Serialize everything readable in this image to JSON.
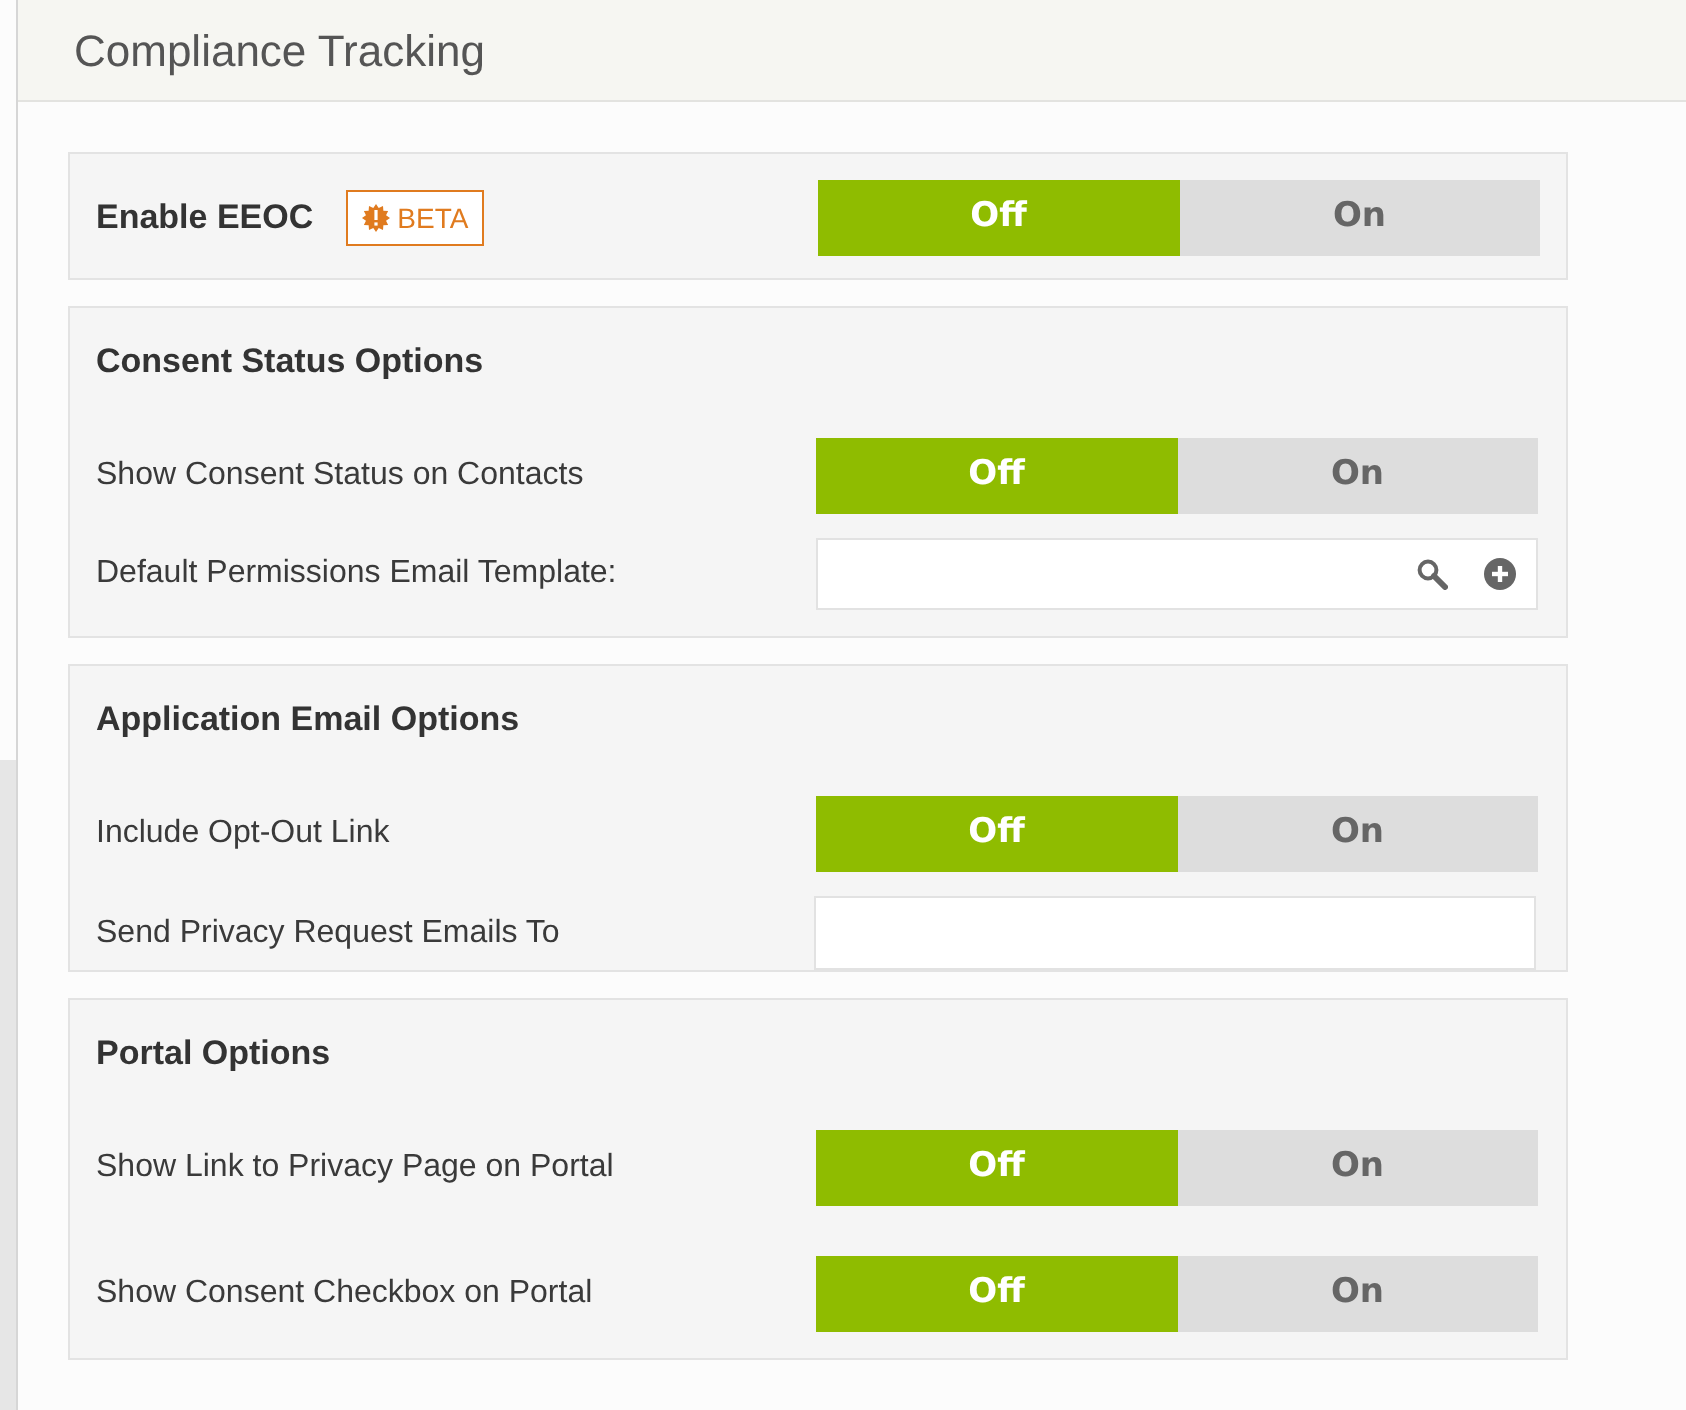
{
  "header": {
    "title": "Compliance Tracking"
  },
  "sections": [
    {
      "kind": "inline",
      "label": "Enable EEOC",
      "badge": "BETA",
      "toggle": {
        "off_label": "Off",
        "on_label": "On",
        "on": false
      }
    },
    {
      "kind": "group",
      "title": "Consent Status Options",
      "rows": [
        {
          "kind": "toggle",
          "label": "Show Consent Status on Contacts",
          "toggle": {
            "off_label": "Off",
            "on_label": "On",
            "on": false
          }
        },
        {
          "kind": "lookup",
          "label": "Default Permissions Email Template:"
        }
      ]
    },
    {
      "kind": "group",
      "title": "Application Email Options",
      "rows": [
        {
          "kind": "toggle",
          "label": "Include Opt-Out Link",
          "toggle": {
            "off_label": "Off",
            "on_label": "On",
            "on": false
          }
        },
        {
          "kind": "text",
          "label": "Send Privacy Request Emails To"
        }
      ]
    },
    {
      "kind": "group",
      "title": "Portal Options",
      "rows": [
        {
          "kind": "toggle",
          "label": "Show Link to Privacy Page on Portal",
          "toggle": {
            "off_label": "Off",
            "on_label": "On",
            "on": false
          }
        },
        {
          "kind": "toggle",
          "label": "Show Consent Checkbox on Portal",
          "toggle": {
            "off_label": "Off",
            "on_label": "On",
            "on": false
          }
        }
      ]
    }
  ]
}
